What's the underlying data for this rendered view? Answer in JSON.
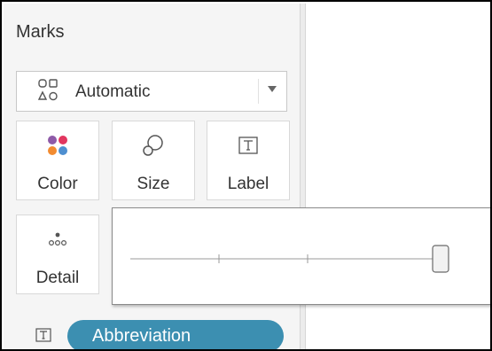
{
  "marks_panel": {
    "title": "Marks",
    "mark_type": {
      "selected": "Automatic",
      "icon": "automatic-shapes-icon",
      "dropdown_icon": "chevron-down-icon"
    },
    "cards": [
      {
        "label": "Color",
        "icon": "color-palette-icon"
      },
      {
        "label": "Size",
        "icon": "size-icon"
      },
      {
        "label": "Label",
        "icon": "text-label-icon"
      },
      {
        "label": "Detail",
        "icon": "detail-icon"
      }
    ],
    "field_pill": {
      "label": "Abbreviation",
      "encoding_icon": "text-label-icon",
      "color": "#3c8fb1"
    }
  },
  "size_slider": {
    "value": 1.0,
    "tick_count": 2
  },
  "colors": {
    "color_icon_dots": [
      "#8e5aa8",
      "#e2365f",
      "#f28b30",
      "#4e8fd0"
    ]
  }
}
